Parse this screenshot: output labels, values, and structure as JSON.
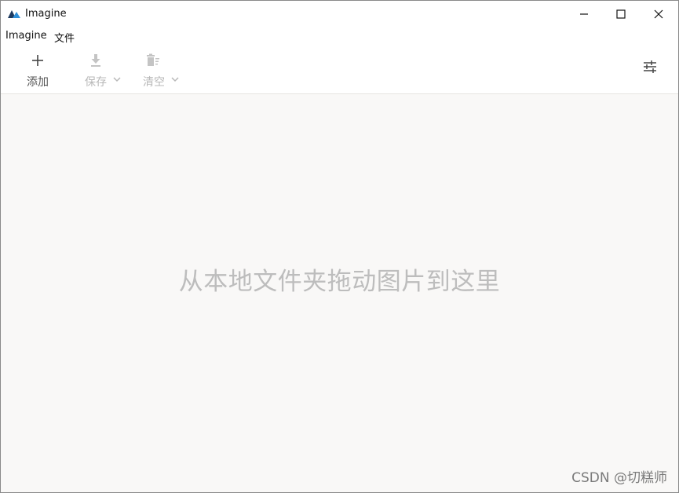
{
  "window": {
    "title": "Imagine",
    "controls": [
      "minimize",
      "maximize",
      "close"
    ]
  },
  "menu": {
    "items": [
      "Imagine",
      "文件"
    ]
  },
  "toolbar": {
    "add_label": "添加",
    "save_label": "保存",
    "clear_label": "清空",
    "save_enabled": false,
    "clear_enabled": false,
    "icons": {
      "add": "plus-icon",
      "save": "download-icon",
      "clear": "trash-icon",
      "settings": "sliders-icon"
    }
  },
  "drop_area": {
    "hint": "从本地文件夹拖动图片到这里"
  },
  "watermark": "CSDN @切糕师",
  "colors": {
    "logo_dark": "#1e3a5f",
    "logo_accent": "#2f8fd8",
    "background": "#f9f8f7",
    "hint_text": "#bdbdbd"
  }
}
